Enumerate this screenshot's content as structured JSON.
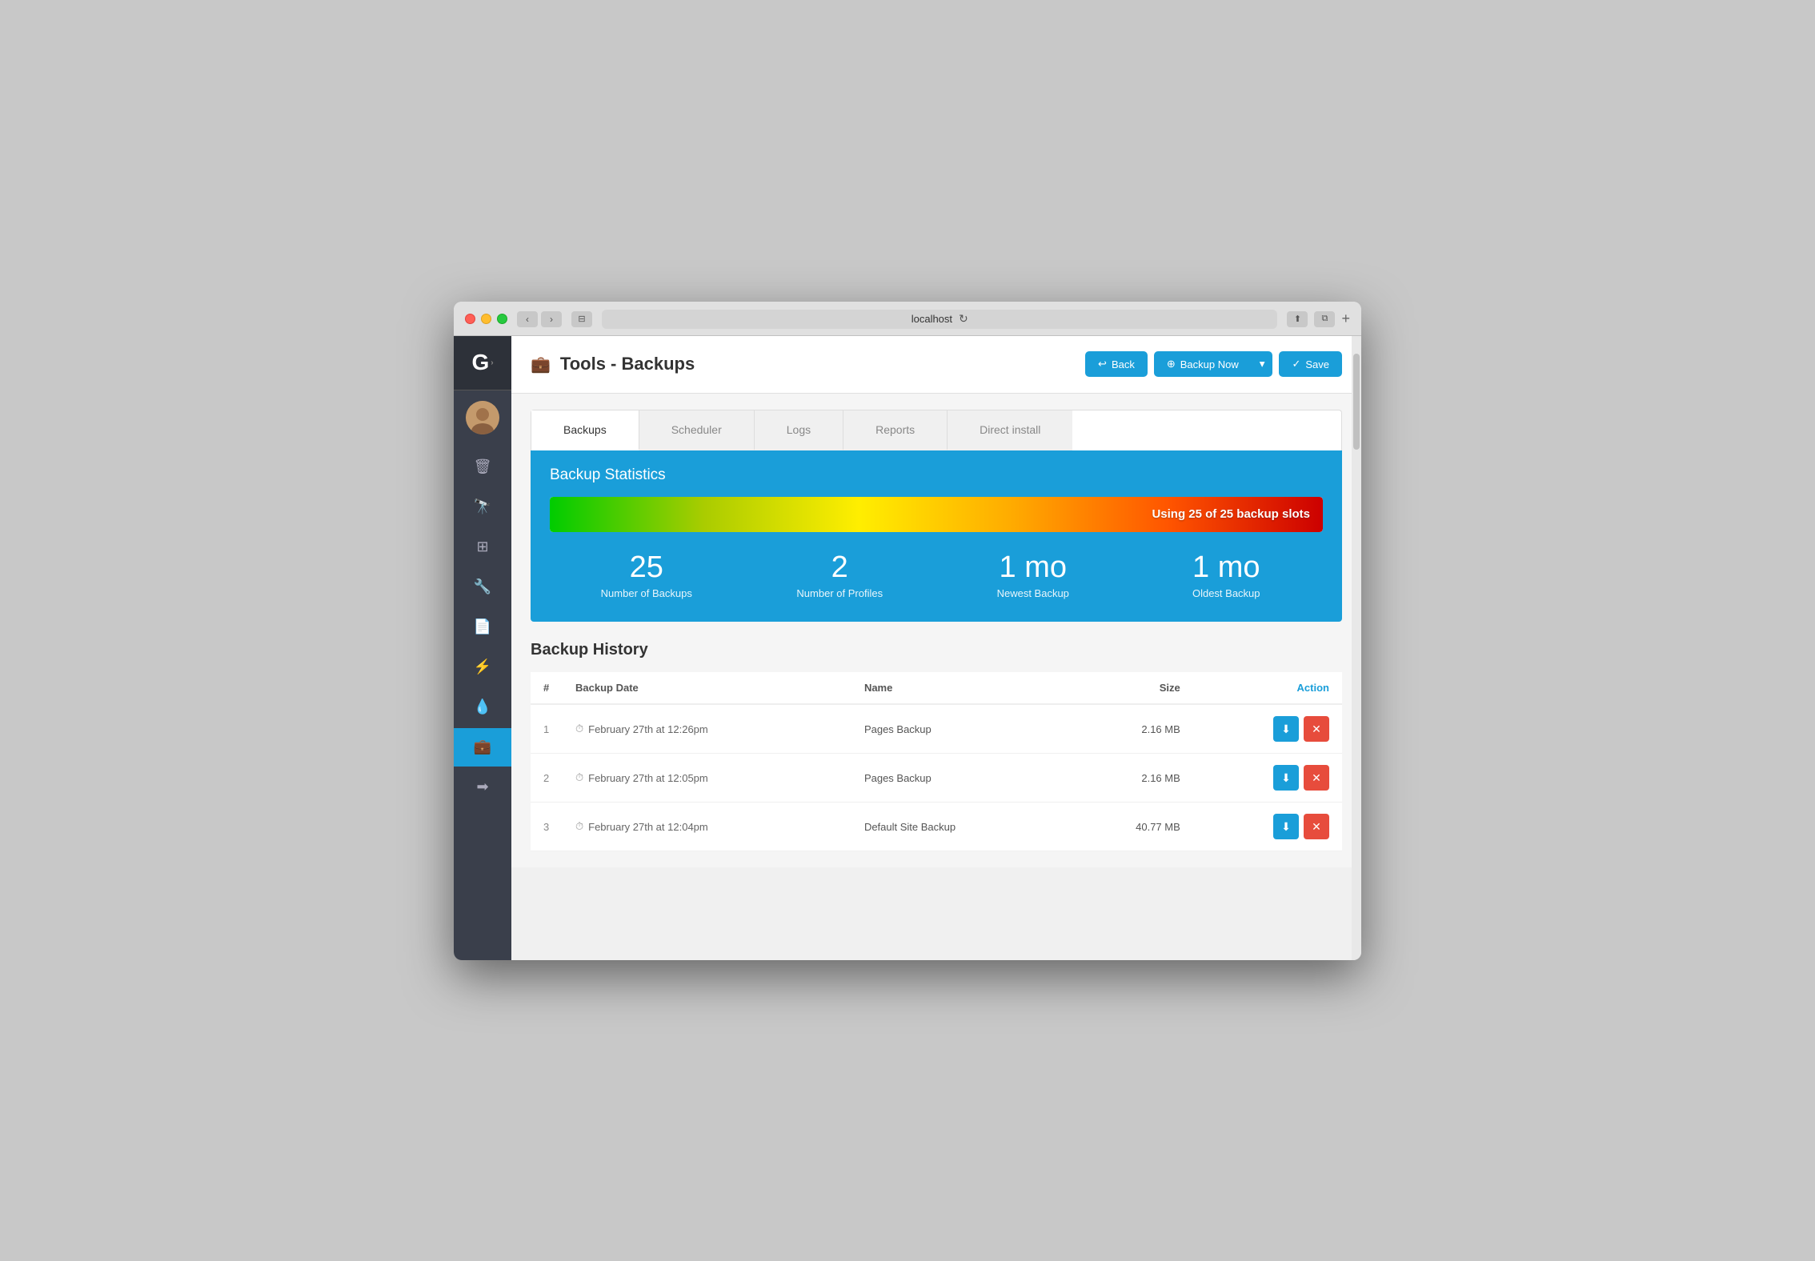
{
  "browser": {
    "url": "localhost",
    "back_label": "‹",
    "forward_label": "›"
  },
  "header": {
    "title": "Tools - Backups",
    "back_button": "Back",
    "backup_now_button": "Backup Now",
    "save_button": "Save"
  },
  "tabs": [
    {
      "label": "Backups",
      "active": true
    },
    {
      "label": "Scheduler",
      "active": false
    },
    {
      "label": "Logs",
      "active": false
    },
    {
      "label": "Reports",
      "active": false
    },
    {
      "label": "Direct install",
      "active": false
    }
  ],
  "stats": {
    "title": "Backup Statistics",
    "meter_label": "Using 25 of 25 backup slots",
    "items": [
      {
        "value": "25",
        "label": "Number of Backups"
      },
      {
        "value": "2",
        "label": "Number of Profiles"
      },
      {
        "value": "1 mo",
        "label": "Newest Backup"
      },
      {
        "value": "1 mo",
        "label": "Oldest Backup"
      }
    ]
  },
  "history": {
    "title": "Backup History",
    "columns": [
      "#",
      "Backup Date",
      "Name",
      "Size",
      "Action"
    ],
    "rows": [
      {
        "num": "1",
        "date": "February 27th at 12:26pm",
        "name": "Pages Backup",
        "size": "2.16 MB"
      },
      {
        "num": "2",
        "date": "February 27th at 12:05pm",
        "name": "Pages Backup",
        "size": "2.16 MB"
      },
      {
        "num": "3",
        "date": "February 27th at 12:04pm",
        "name": "Default Site Backup",
        "size": "40.77 MB"
      }
    ]
  },
  "sidebar": {
    "items": [
      {
        "icon": "🗑",
        "name": "trash"
      },
      {
        "icon": "🔭",
        "name": "binoculars"
      },
      {
        "icon": "⊞",
        "name": "grid"
      },
      {
        "icon": "🔧",
        "name": "wrench"
      },
      {
        "icon": "📄",
        "name": "document"
      },
      {
        "icon": "⚡",
        "name": "lightning"
      },
      {
        "icon": "💧",
        "name": "droplet"
      },
      {
        "icon": "💼",
        "name": "briefcase"
      },
      {
        "icon": "➡",
        "name": "arrow-right"
      }
    ]
  }
}
